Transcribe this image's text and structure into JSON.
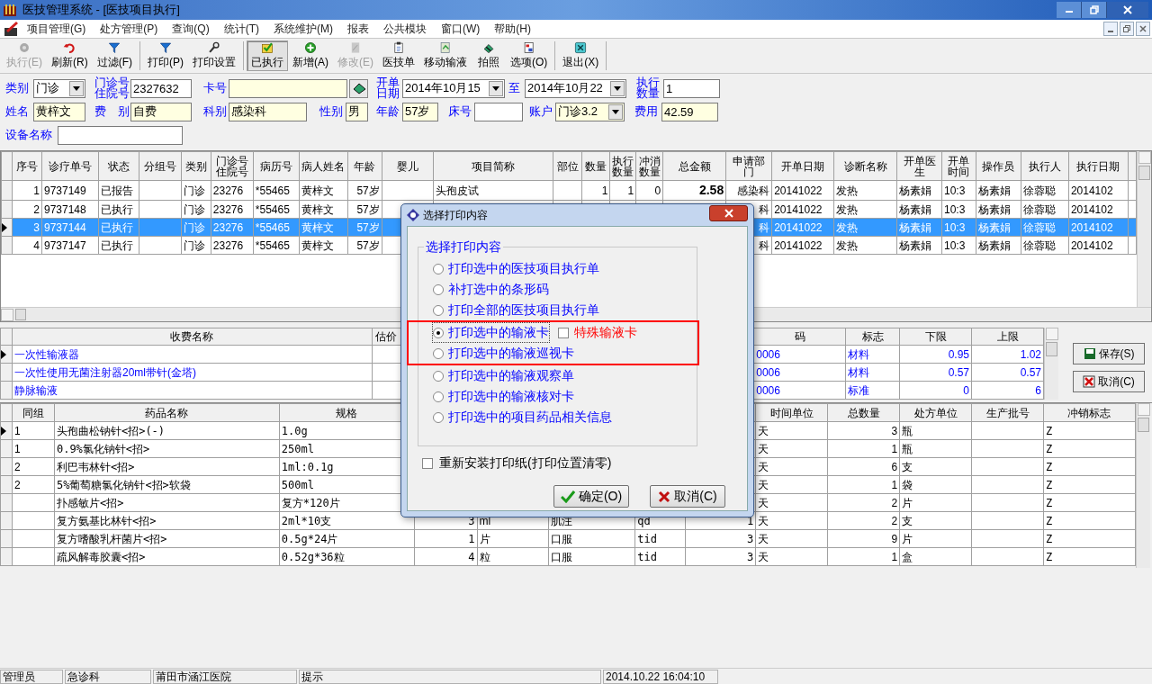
{
  "window": {
    "title": "医技管理系统 - [医技项目执行]"
  },
  "menu": [
    "项目管理(G)",
    "处方管理(P)",
    "查询(Q)",
    "统计(T)",
    "系统维护(M)",
    "报表",
    "公共模块",
    "窗口(W)",
    "帮助(H)"
  ],
  "toolbar": [
    [
      {
        "label": "执行(E)",
        "disabled": true,
        "pressed": false
      },
      {
        "label": "刷新(R)",
        "disabled": false,
        "pressed": false
      },
      {
        "label": "过滤(F)",
        "disabled": false,
        "pressed": false
      }
    ],
    [
      {
        "label": "打印(P)",
        "disabled": false,
        "pressed": false
      },
      {
        "label": "打印设置",
        "disabled": false,
        "pressed": false
      }
    ],
    [
      {
        "label": "已执行",
        "disabled": false,
        "pressed": true
      },
      {
        "label": "新增(A)",
        "disabled": false,
        "pressed": false
      },
      {
        "label": "修改(E)",
        "disabled": true,
        "pressed": false
      },
      {
        "label": "医技单",
        "disabled": false,
        "pressed": false
      },
      {
        "label": "移动输液",
        "disabled": false,
        "pressed": false
      },
      {
        "label": "拍照",
        "disabled": false,
        "pressed": false
      },
      {
        "label": "选项(O)",
        "disabled": false,
        "pressed": false
      }
    ],
    [
      {
        "label": "退出(X)",
        "disabled": false,
        "pressed": false
      }
    ]
  ],
  "form": [
    [
      {
        "kind": "select",
        "label": [
          "类别"
        ],
        "value": "门诊",
        "highlight": false
      },
      {
        "kind": "text",
        "label": [
          "门诊号",
          "住院号"
        ],
        "value": "2327632",
        "highlight": false
      },
      {
        "kind": "text",
        "label": [
          "卡号"
        ],
        "highlight": true
      },
      {
        "kind": "button"
      },
      {
        "kind": "select",
        "label": [
          "开单",
          "日期"
        ],
        "value": "2014年10月15",
        "highlight": false
      },
      {
        "kind": "select",
        "label": [
          "至"
        ],
        "value": "2014年10月22",
        "highlight": false
      },
      {
        "kind": "text",
        "label": [
          "执行",
          "数量"
        ],
        "value": "1",
        "highlight": false
      }
    ],
    [
      {
        "kind": "text",
        "label": [
          "姓名"
        ],
        "value": "黄梓文",
        "highlight": true
      },
      {
        "kind": "text",
        "label": [
          "费　别"
        ],
        "value": "自费",
        "highlight": true
      },
      {
        "kind": "text",
        "label": [
          "科别"
        ],
        "value": "感染科",
        "highlight": true
      },
      {
        "kind": "text",
        "label": [
          "性别"
        ],
        "value": "男",
        "highlight": true
      },
      {
        "kind": "text",
        "label": [
          "年龄"
        ],
        "value": "57岁",
        "highlight": true
      },
      {
        "kind": "text",
        "label": [
          "床号"
        ],
        "highlight": false
      },
      {
        "kind": "select",
        "label": [
          "账户"
        ],
        "value": "门诊3.2",
        "highlight": true
      },
      {
        "kind": "text",
        "label": [
          "费用"
        ],
        "value": "42.59",
        "highlight": true
      }
    ],
    [
      {
        "kind": "text",
        "label": [
          "设备名称"
        ],
        "highlight": false
      }
    ]
  ],
  "exec_table": {
    "columns": [
      [
        "序号"
      ],
      [
        "诊疗单号"
      ],
      [
        "状态"
      ],
      [
        "分组号"
      ],
      [
        "类别"
      ],
      [
        "门诊号",
        "住院号"
      ],
      [
        "病历号"
      ],
      [
        "病人姓名"
      ],
      [
        "年龄"
      ],
      [
        "婴儿"
      ],
      [
        "项目简称"
      ],
      [
        "部位"
      ],
      [
        "数量"
      ],
      [
        "执行",
        "数量"
      ],
      [
        "冲消",
        "数量"
      ],
      [
        "总金额"
      ],
      [
        "申请部",
        "门"
      ],
      [
        "开单日期"
      ],
      [
        "诊断名称"
      ],
      [
        "开单医",
        "生"
      ],
      [
        "开单",
        "时间"
      ],
      [
        "操作员"
      ],
      [
        "执行人"
      ],
      [
        "执行日期"
      ],
      null
    ],
    "rows": [
      {
        "selected": false,
        "cells": [
          "1",
          "9737149",
          "已报告",
          null,
          "门诊",
          "23276",
          "*55465",
          "黄梓文",
          "57岁",
          null,
          "头孢皮试",
          null,
          "1",
          "1",
          "0",
          "2.58",
          "感染科",
          "20141022",
          "发热",
          "杨素娟",
          "10:3",
          "杨素娟",
          "徐蓉聪",
          "2014102",
          null
        ]
      },
      {
        "selected": false,
        "cells": [
          "2",
          "9737148",
          "已执行",
          null,
          "门诊",
          "23276",
          "*55465",
          "黄梓文",
          "57岁",
          null,
          null,
          null,
          null,
          null,
          null,
          null,
          "科",
          "20141022",
          "发热",
          "杨素娟",
          "10:3",
          "杨素娟",
          "徐蓉聪",
          "2014102",
          null
        ]
      },
      {
        "selected": true,
        "cells": [
          "3",
          "9737144",
          "已执行",
          null,
          "门诊",
          "23276",
          "*55465",
          "黄梓文",
          "57岁",
          null,
          null,
          null,
          null,
          null,
          null,
          null,
          "科",
          "20141022",
          "发热",
          "杨素娟",
          "10:3",
          "杨素娟",
          "徐蓉聪",
          "2014102",
          null
        ]
      },
      {
        "selected": false,
        "cells": [
          "4",
          "9737147",
          "已执行",
          null,
          "门诊",
          "23276",
          "*55465",
          "黄梓文",
          "57岁",
          null,
          null,
          null,
          null,
          null,
          null,
          null,
          "科",
          "20141022",
          "发热",
          "杨素娟",
          "10:3",
          "杨素娟",
          "徐蓉聪",
          "2014102",
          null
        ]
      }
    ]
  },
  "fee_table": {
    "columns": [
      "收费名称",
      "估价",
      null,
      "码",
      "标志",
      "下限",
      "上限"
    ],
    "rows": [
      {
        "selected": true,
        "cells": [
          "一次性输液器",
          null,
          null,
          "0006",
          "材料",
          "0.95",
          "1.02"
        ]
      },
      {
        "selected": false,
        "cells": [
          "一次性使用无菌注射器20ml带针(金塔)",
          null,
          null,
          "0006",
          "材料",
          "0.57",
          "0.57"
        ]
      },
      {
        "selected": false,
        "cells": [
          "静脉输液",
          null,
          null,
          "0006",
          "标准",
          "0",
          "6"
        ]
      }
    ]
  },
  "fee_buttons": [
    {
      "kind": "save",
      "label": "保存(S)"
    },
    {
      "kind": "cancel",
      "label": "取消(C)"
    }
  ],
  "drug_table": {
    "columns": [
      "同组",
      "药品名称",
      "规格",
      null,
      null,
      null,
      null,
      null,
      "时间单位",
      "总数量",
      "处方单位",
      "生产批号",
      "冲销标志"
    ],
    "rows": [
      {
        "selected": true,
        "cells": [
          "1",
          "头孢曲松钠针<招>(-)",
          "1.0g",
          null,
          null,
          null,
          null,
          null,
          "天",
          "3",
          "瓶",
          null,
          "Z"
        ]
      },
      {
        "selected": false,
        "cells": [
          "1",
          "0.9%氯化钠针<招>",
          "250ml",
          null,
          null,
          null,
          null,
          null,
          "天",
          "1",
          "瓶",
          null,
          "Z"
        ]
      },
      {
        "selected": false,
        "cells": [
          "2",
          "利巴韦林针<招>",
          "1ml:0.1g",
          null,
          null,
          null,
          null,
          null,
          "天",
          "6",
          "支",
          null,
          "Z"
        ]
      },
      {
        "selected": false,
        "cells": [
          "2",
          "5%葡萄糖氯化钠针<招>软袋",
          "500ml",
          null,
          null,
          null,
          null,
          null,
          "天",
          "1",
          "袋",
          null,
          "Z"
        ]
      },
      {
        "selected": false,
        "cells": [
          null,
          "扑感敏片<招>",
          "复方*120片",
          null,
          null,
          null,
          null,
          null,
          "天",
          "2",
          "片",
          null,
          "Z"
        ]
      },
      {
        "selected": false,
        "cells": [
          null,
          "复方氨基比林针<招>",
          "2ml*10支",
          "3",
          "ml",
          "肌注",
          "qd",
          "1",
          "天",
          "2",
          "支",
          null,
          "Z"
        ]
      },
      {
        "selected": false,
        "cells": [
          null,
          "复方嗜酸乳杆菌片<招>",
          "0.5g*24片",
          "1",
          "片",
          "口服",
          "tid",
          "3",
          "天",
          "9",
          "片",
          null,
          "Z"
        ]
      },
      {
        "selected": false,
        "cells": [
          null,
          "疏风解毒胶囊<招>",
          "0.52g*36粒",
          "4",
          "粒",
          "口服",
          "tid",
          "3",
          "天",
          "1",
          "盒",
          null,
          "Z"
        ]
      }
    ]
  },
  "dialog": {
    "title": "选择打印内容",
    "group_title": "选择打印内容",
    "options": [
      {
        "label": "打印选中的医技项目执行单",
        "selected": false,
        "marked": false
      },
      {
        "label": "补打选中的条形码",
        "selected": false,
        "marked": false
      },
      {
        "label": "打印全部的医技项目执行单",
        "selected": false,
        "marked": false
      },
      {
        "label": "打印选中的输液卡",
        "selected": true,
        "marked": true,
        "checkbox": {
          "label": "特殊输液卡",
          "checked": false
        }
      },
      {
        "label": "打印选中的输液巡视卡",
        "selected": false,
        "marked": true
      },
      {
        "label": "打印选中的输液观察单",
        "selected": false,
        "marked": false
      },
      {
        "label": "打印选中的输液核对卡",
        "selected": false,
        "marked": false
      },
      {
        "label": "打印选中的项目药品相关信息",
        "selected": false,
        "marked": false
      }
    ],
    "reset_paper": {
      "label": "重新安装打印纸(打印位置清零)",
      "checked": false
    },
    "buttons": [
      {
        "kind": "ok",
        "label": "确定(O)"
      },
      {
        "kind": "cancel",
        "label": "取消(C)"
      }
    ]
  },
  "status_bar": [
    "管理员",
    "急诊科",
    "莆田市涵江医院",
    "提示",
    "2014.10.22 16:04:10"
  ]
}
